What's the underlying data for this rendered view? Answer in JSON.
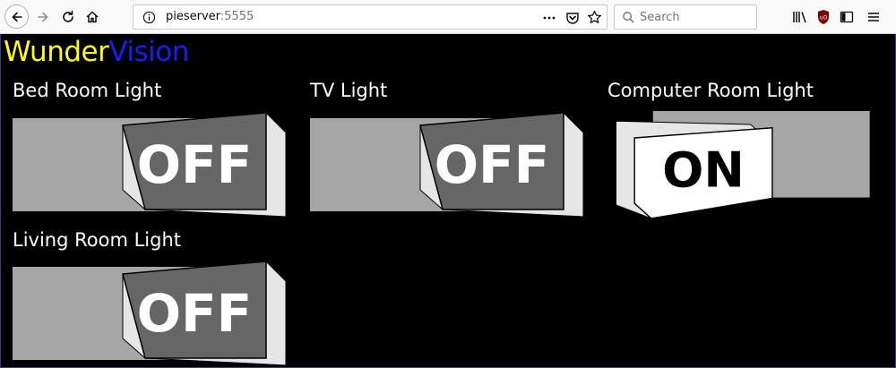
{
  "browser": {
    "url_host": "pieserver",
    "url_port": ":5555",
    "search_placeholder": "Search",
    "icons": [
      "back-arrow-icon",
      "forward-arrow-icon",
      "reload-icon",
      "home-icon",
      "info-icon",
      "more-icon",
      "pocket-icon",
      "bookmark-star-icon",
      "search-icon",
      "library-icon",
      "ublock-icon",
      "sidebar-icon",
      "menu-icon"
    ]
  },
  "app": {
    "logo_part1": "Wunder",
    "logo_part2": "Vision",
    "logo_color1": "#ffff00",
    "logo_color2": "#1a1aff"
  },
  "lights": [
    {
      "name": "Bed Room Light",
      "state": "OFF"
    },
    {
      "name": "TV Light",
      "state": "OFF"
    },
    {
      "name": "Computer Room Light",
      "state": "ON"
    },
    {
      "name": "Living Room Light",
      "state": "OFF"
    }
  ],
  "colors": {
    "track": "#a6a6a6",
    "off_face": "#666666",
    "on_face": "#ffffff",
    "bevel": "#e6e6e6",
    "background": "#000000"
  }
}
